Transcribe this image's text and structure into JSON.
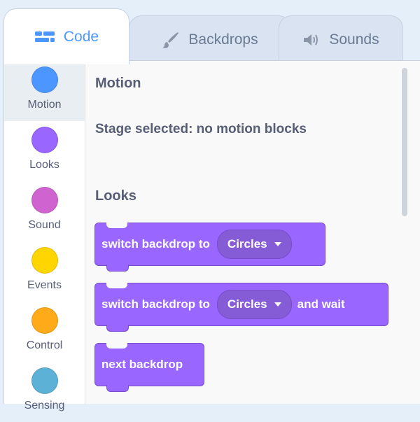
{
  "tabs": {
    "code": {
      "label": "Code",
      "icon": "code-icon"
    },
    "backdrops": {
      "label": "Backdrops",
      "icon": "paintbrush-icon"
    },
    "sounds": {
      "label": "Sounds",
      "icon": "speaker-icon"
    }
  },
  "categories": [
    {
      "label": "Motion",
      "color": "#4c97ff",
      "selected": true
    },
    {
      "label": "Looks",
      "color": "#9966ff"
    },
    {
      "label": "Sound",
      "color": "#cf63cf"
    },
    {
      "label": "Events",
      "color": "#ffd500"
    },
    {
      "label": "Control",
      "color": "#ffab19"
    },
    {
      "label": "Sensing",
      "color": "#5cb1d6"
    }
  ],
  "palette": {
    "motion_heading": "Motion",
    "motion_note": "Stage selected: no motion blocks",
    "looks_heading": "Looks",
    "blocks": {
      "switch_backdrop": {
        "text": "switch backdrop to",
        "menu": "Circles"
      },
      "switch_backdrop_wait": {
        "text": "switch backdrop to",
        "menu": "Circles",
        "suffix": "and wait"
      },
      "next_backdrop": {
        "text": "next backdrop"
      }
    }
  },
  "colors": {
    "accent": "#4c97ff",
    "looks_block": "#9966ff",
    "looks_block_border": "#774dcb"
  }
}
